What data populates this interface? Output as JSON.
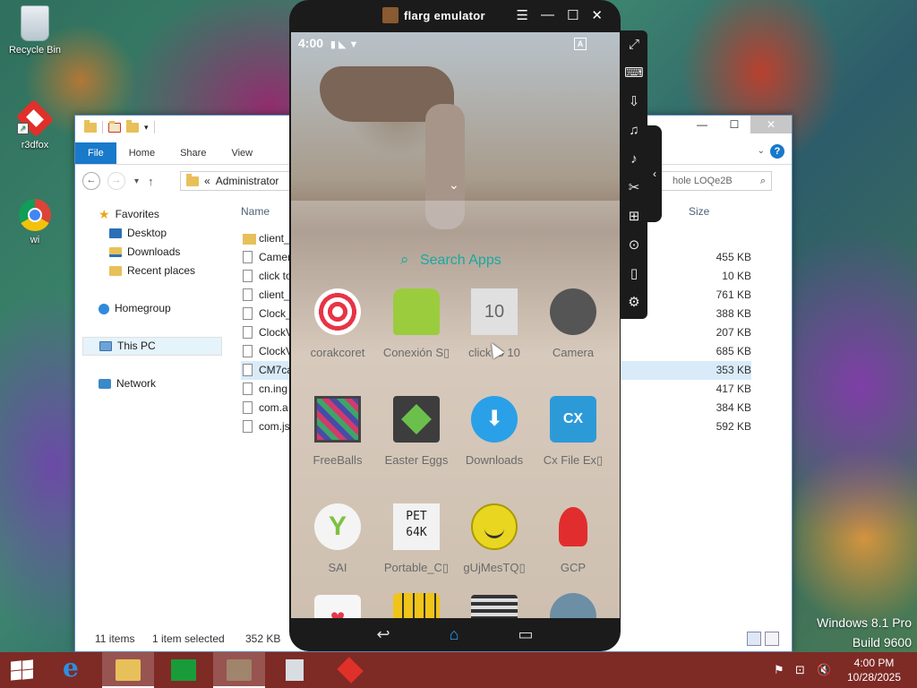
{
  "desktop": {
    "icons": [
      {
        "label": "Recycle Bin"
      },
      {
        "label": "r3dfox"
      },
      {
        "label": "wi"
      }
    ]
  },
  "explorer": {
    "ribbon_tabs": [
      "File",
      "Home",
      "Share",
      "View"
    ],
    "address": {
      "separator": "«",
      "path": "Administrator"
    },
    "search_placeholder": "hole LOQe2B",
    "nav": {
      "favorites": "Favorites",
      "desktop": "Desktop",
      "downloads": "Downloads",
      "recent": "Recent places",
      "homegroup": "Homegroup",
      "this_pc": "This PC",
      "network": "Network"
    },
    "columns": {
      "name": "Name",
      "size": "Size"
    },
    "files": [
      {
        "name": "client_",
        "size": "",
        "type": "folder"
      },
      {
        "name": "Camer",
        "size": "455 KB",
        "type": "file"
      },
      {
        "name": "click to",
        "size": "10 KB",
        "type": "file"
      },
      {
        "name": "client_",
        "size": "761 KB",
        "type": "file"
      },
      {
        "name": "Clock_",
        "size": "388 KB",
        "type": "file"
      },
      {
        "name": "ClockV",
        "size": "207 KB",
        "type": "file"
      },
      {
        "name": "ClockV",
        "size": "685 KB",
        "type": "file"
      },
      {
        "name": "CM7ca",
        "size": "353 KB",
        "type": "file",
        "selected": true
      },
      {
        "name": "cn.ing",
        "size": "417 KB",
        "type": "file"
      },
      {
        "name": "com.a",
        "size": "384 KB",
        "type": "file"
      },
      {
        "name": "com.js",
        "size": "592 KB",
        "type": "file"
      }
    ],
    "status": {
      "items": "11 items",
      "selection": "1 item selected",
      "size": "352 KB"
    }
  },
  "emulator": {
    "title": "flarg emulator",
    "status_time": "4:00",
    "status_icons": "▮ ◣ ▼",
    "drawer_search": "Search Apps",
    "apps": [
      {
        "label": "corakcoret",
        "icon": "target-icon"
      },
      {
        "label": "Conexión S▯",
        "icon": "android-icon"
      },
      {
        "label": "click to 10",
        "icon": "ten-icon",
        "glyph": "10"
      },
      {
        "label": "Camera",
        "icon": "camera-icon"
      },
      {
        "label": "FreeBalls",
        "icon": "freeballs-icon"
      },
      {
        "label": "Easter Eggs",
        "icon": "easter-eggs-icon"
      },
      {
        "label": "Downloads",
        "icon": "downloads-icon"
      },
      {
        "label": "Cx File Ex▯",
        "icon": "cx-file-icon",
        "glyph": "CX"
      },
      {
        "label": "SAI",
        "icon": "sai-icon",
        "glyph": "Y"
      },
      {
        "label": "Portable_C▯",
        "icon": "pet-icon",
        "glyph": "PET 64K"
      },
      {
        "label": "gUjMesTQ▯",
        "icon": "smiley-icon"
      },
      {
        "label": "GCP",
        "icon": "gcp-icon"
      },
      {
        "label": "",
        "icon": "heart-app-icon",
        "glyph": "♥"
      },
      {
        "label": "",
        "icon": "blocks-app-icon"
      },
      {
        "label": "",
        "icon": "qr-app-icon"
      },
      {
        "label": "",
        "icon": "settings-app-icon"
      }
    ]
  },
  "watermark": {
    "line1": "Windows 8.1 Pro",
    "line2": "Build 9600"
  },
  "taskbar": {
    "time": "4:00 PM",
    "date": "10/28/2025"
  }
}
